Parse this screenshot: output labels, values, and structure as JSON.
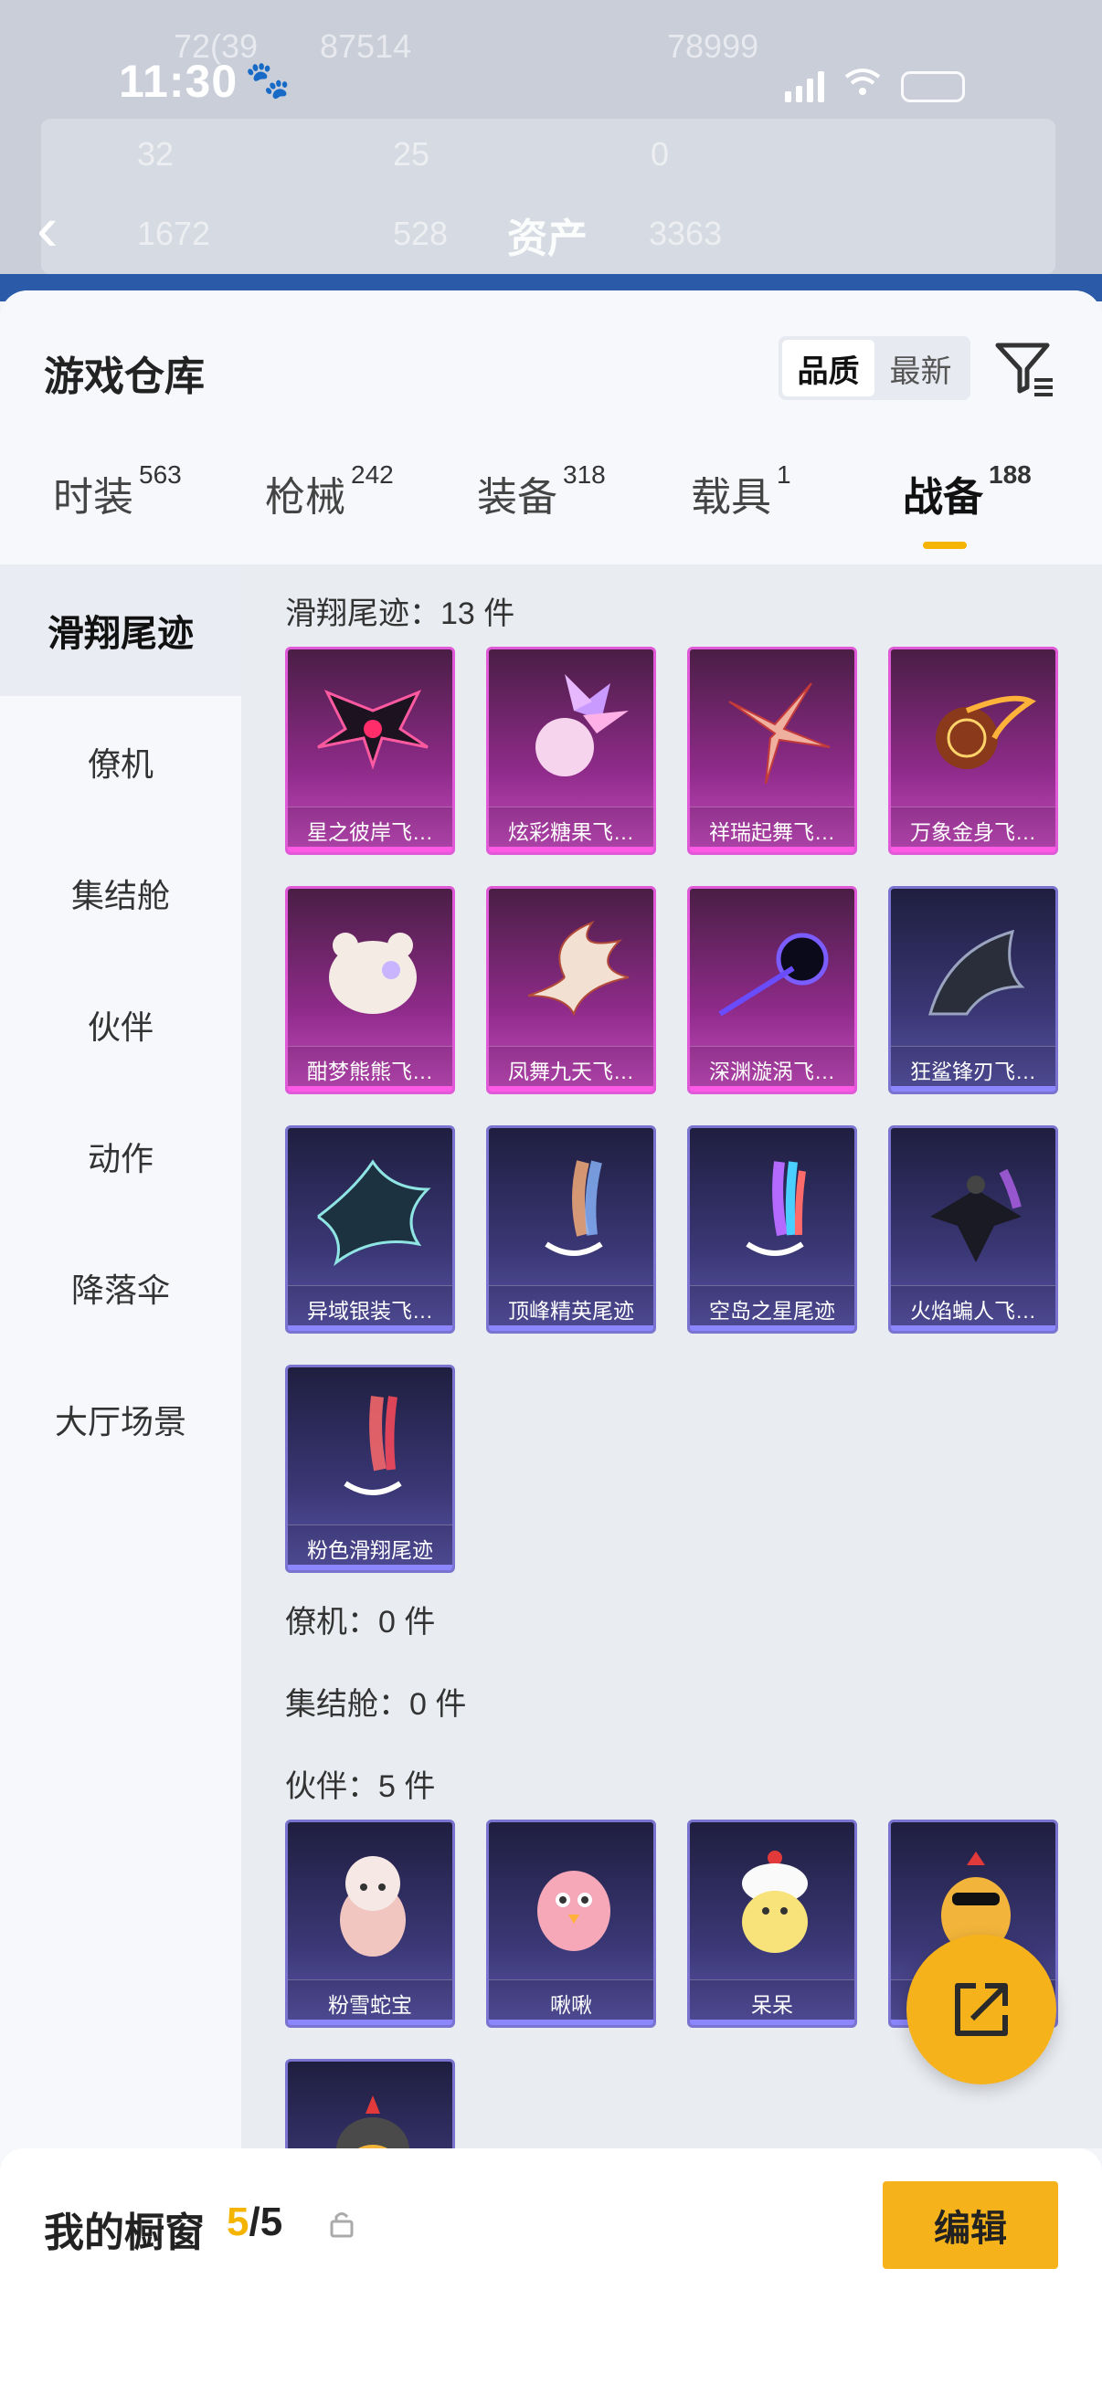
{
  "status_bar": {
    "time": "11:30"
  },
  "background": {
    "title": "资产",
    "faded": [
      "72(39",
      "87514",
      "78999",
      "32",
      "25",
      "0",
      "1672",
      "528",
      "3363"
    ]
  },
  "header": {
    "title": "游戏仓库",
    "sort_options": [
      "品质",
      "最新"
    ],
    "sort_selected": "品质"
  },
  "tabs": [
    {
      "label": "时装",
      "count": "563"
    },
    {
      "label": "枪械",
      "count": "242"
    },
    {
      "label": "装备",
      "count": "318"
    },
    {
      "label": "载具",
      "count": "1"
    },
    {
      "label": "战备",
      "count": "188"
    }
  ],
  "active_tab": "战备",
  "sidebar": {
    "items": [
      "滑翔尾迹",
      "僚机",
      "集结舱",
      "伙伴",
      "动作",
      "降落伞",
      "大厅场景"
    ],
    "active": "滑翔尾迹"
  },
  "sections": [
    {
      "title": "滑翔尾迹：13 件",
      "items": [
        {
          "name": "星之彼岸飞…",
          "rarity": "pink"
        },
        {
          "name": "炫彩糖果飞…",
          "rarity": "pink"
        },
        {
          "name": "祥瑞起舞飞…",
          "rarity": "pink"
        },
        {
          "name": "万象金身飞…",
          "rarity": "pink"
        },
        {
          "name": "酣梦熊熊飞…",
          "rarity": "pink"
        },
        {
          "name": "凤舞九天飞…",
          "rarity": "pink"
        },
        {
          "name": "深渊漩涡飞…",
          "rarity": "pink"
        },
        {
          "name": "狂鲨锋刃飞…",
          "rarity": "blue"
        },
        {
          "name": "异域银装飞…",
          "rarity": "blue"
        },
        {
          "name": "顶峰精英尾迹",
          "rarity": "blue"
        },
        {
          "name": "空岛之星尾迹",
          "rarity": "blue"
        },
        {
          "name": "火焰蝙人飞…",
          "rarity": "blue"
        },
        {
          "name": "粉色滑翔尾迹",
          "rarity": "blue"
        }
      ]
    },
    {
      "title": "僚机：0 件",
      "items": []
    },
    {
      "title": "集结舱：0 件",
      "items": []
    },
    {
      "title": "伙伴：5 件",
      "items": [
        {
          "name": "粉雪蛇宝",
          "rarity": "blue"
        },
        {
          "name": "啾啾",
          "rarity": "blue"
        },
        {
          "name": "呆呆",
          "rarity": "blue"
        },
        {
          "name": "",
          "rarity": "blue"
        },
        {
          "name": "",
          "rarity": "blue"
        }
      ]
    }
  ],
  "showcase": {
    "title": "我的橱窗",
    "current": "5",
    "separator": "/",
    "total": "5",
    "edit_label": "编辑"
  },
  "colors": {
    "accent": "#f5b400",
    "pink_rarity": "#c64dc0",
    "blue_rarity": "#5a55a8"
  }
}
